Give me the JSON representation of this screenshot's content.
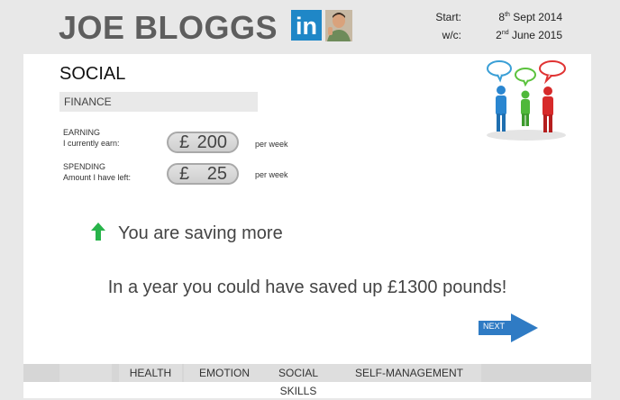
{
  "header": {
    "name": "JOE BLOGGS",
    "linkedin_label": "in",
    "start_label": "Start:",
    "start_day": "8",
    "start_day_suffix": "th",
    "start_rest": " Sept 2014",
    "wc_label": "w/c:",
    "wc_day": "2",
    "wc_day_suffix": "nd",
    "wc_rest": " June 2015"
  },
  "page": {
    "title": "SOCIAL",
    "section": "FINANCE"
  },
  "earning": {
    "label_line1": "EARNING",
    "label_line2": "I currently earn:",
    "currency": "£",
    "amount": "200",
    "period": "per week"
  },
  "spending": {
    "label_line1": "SPENDING",
    "label_line2": "Amount I have left:",
    "currency": "£",
    "amount": "25",
    "period": "per week"
  },
  "status": {
    "saving_text": "You are saving more",
    "year_text": "In a year you could have saved up £1300 pounds!"
  },
  "next_label": "NEXT",
  "nav": {
    "items": [
      "",
      "HEALTH",
      "EMOTION",
      "SOCIAL SKILLS",
      "SELF-MANAGEMENT"
    ]
  },
  "colors": {
    "linkedin": "#1f87c7",
    "next": "#2f7bc4",
    "arrow_up": "#28b44a"
  }
}
